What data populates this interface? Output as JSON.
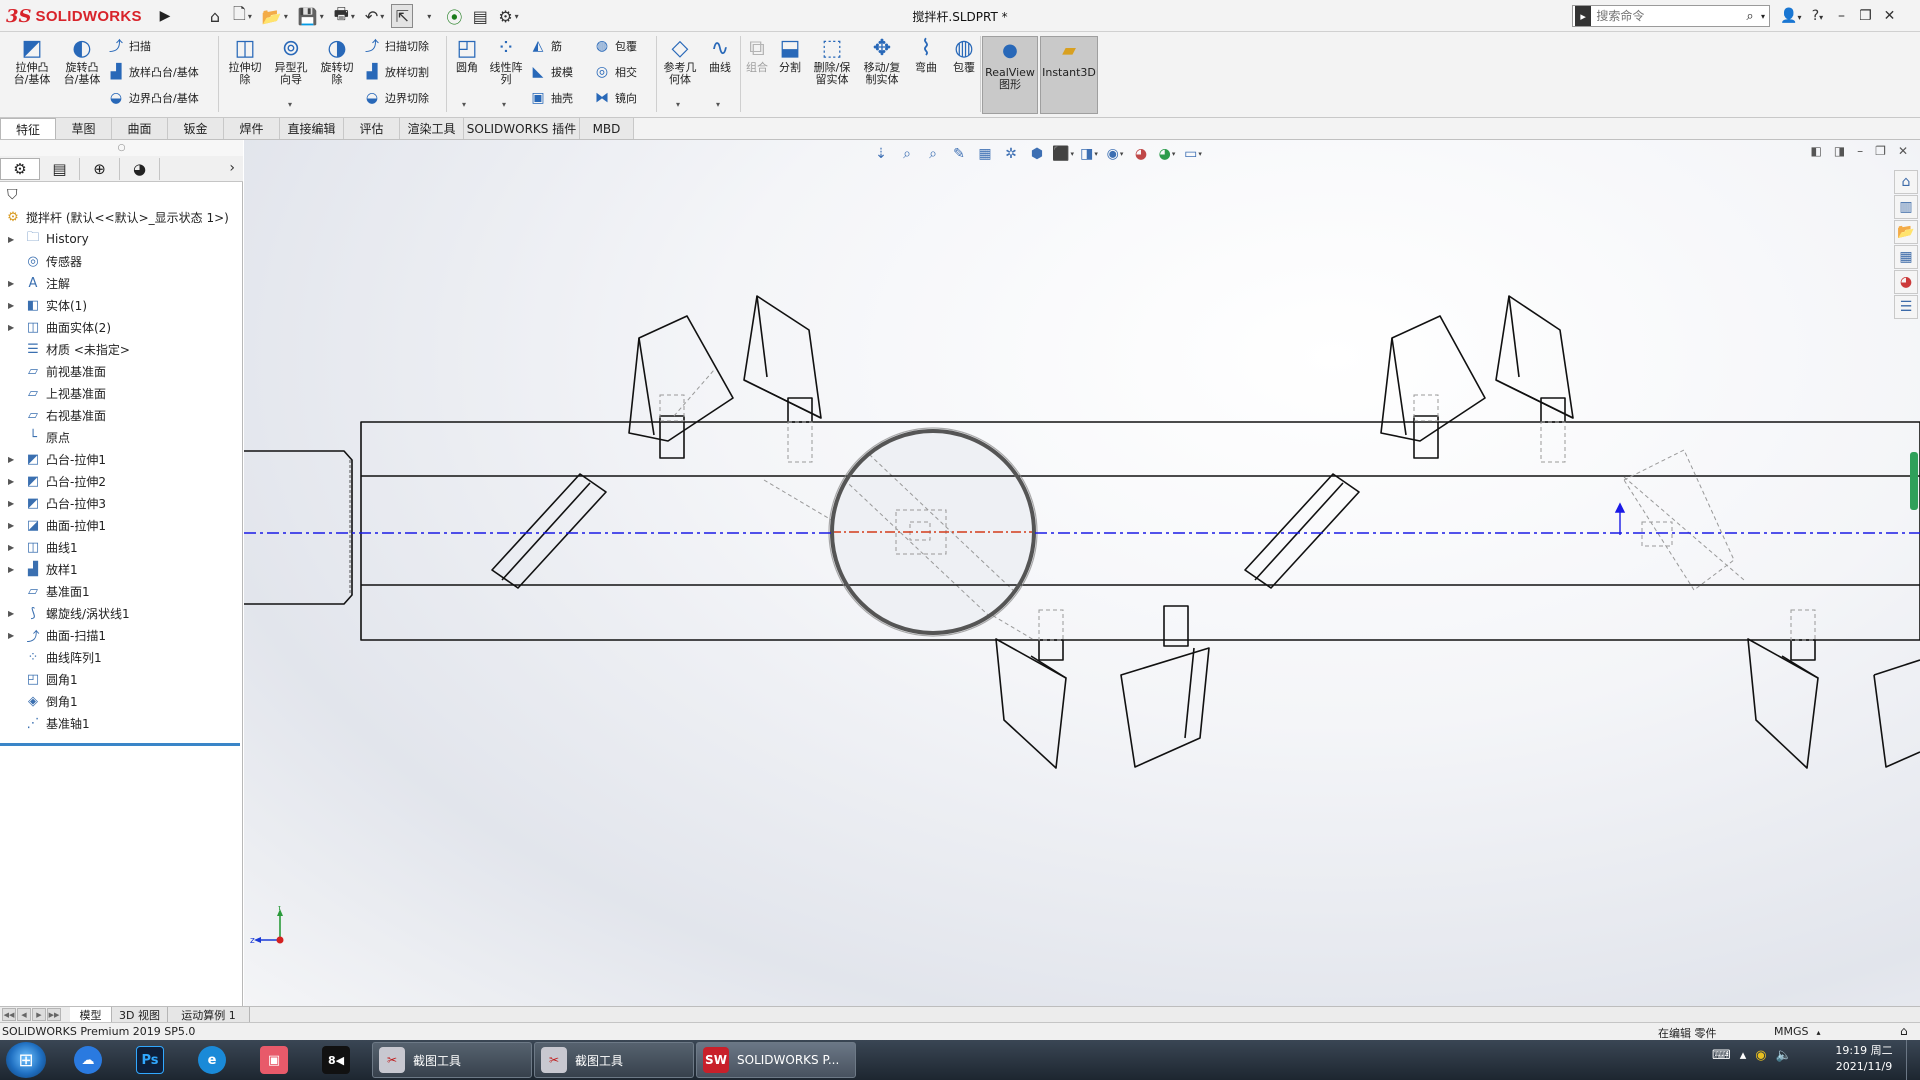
{
  "app": {
    "brand_prefix": "3S",
    "brand": "SOLIDWORKS",
    "document_title": "搅拌杆.SLDPRT *"
  },
  "search": {
    "placeholder": "搜索命令"
  },
  "quick_access": [
    {
      "name": "home-icon",
      "glyph": "⌂"
    },
    {
      "name": "new-document-icon",
      "glyph": "🗋"
    },
    {
      "name": "open-icon",
      "glyph": "📂"
    },
    {
      "name": "save-icon",
      "glyph": "💾"
    },
    {
      "name": "print-icon",
      "glyph": "🖶"
    },
    {
      "name": "undo-icon",
      "glyph": "↶"
    },
    {
      "name": "select-arrow-icon",
      "glyph": "⇱"
    },
    {
      "name": "rebuild-icon",
      "glyph": "⦿"
    },
    {
      "name": "file-properties-icon",
      "glyph": "▤"
    },
    {
      "name": "options-gear-icon",
      "glyph": "⚙"
    }
  ],
  "commands": {
    "extrude_boss": "拉伸凸\n台/基体",
    "revolve_boss": "旋转凸\n台/基体",
    "sweep": "扫描",
    "loft_boss": "放样凸台/基体",
    "boundary_boss": "边界凸台/基体",
    "extrude_cut": "拉伸切\n除",
    "hole_wizard": "异型孔\n向导",
    "revolve_cut": "旋转切\n除",
    "swept_cut": "扫描切除",
    "lofted_cut": "放样切割",
    "boundary_cut": "边界切除",
    "fillet": "圆角",
    "linear_pattern": "线性阵\n列",
    "rib": "筋",
    "draft": "拔模",
    "shell": "抽壳",
    "wrap": "包覆",
    "intersect": "相交",
    "mirror": "镜向",
    "ref_geometry": "参考几\n何体",
    "curves": "曲线",
    "combine": "组合",
    "split": "分割",
    "delete_keep_body": "删除/保\n留实体",
    "move_copy_body": "移动/复\n制实体",
    "flex": "弯曲",
    "wrap2": "包覆",
    "realview": "RealView\n图形",
    "instant3d": "Instant3D"
  },
  "tabs": [
    "特征",
    "草图",
    "曲面",
    "钣金",
    "焊件",
    "直接编辑",
    "评估",
    "渲染工具",
    "SOLIDWORKS 插件",
    "MBD"
  ],
  "active_tab": "特征",
  "tree": {
    "root": "搅拌杆 (默认<<默认>_显示状态 1>)",
    "items": [
      {
        "label": "History",
        "icon": "history-folder-icon",
        "glyph": "🗀",
        "expandable": true
      },
      {
        "label": "传感器",
        "icon": "sensors-icon",
        "glyph": "◎",
        "expandable": false
      },
      {
        "label": "注解",
        "icon": "annotations-icon",
        "glyph": "A",
        "expandable": true
      },
      {
        "label": "实体(1)",
        "icon": "solid-bodies-icon",
        "glyph": "◧",
        "expandable": true
      },
      {
        "label": "曲面实体(2)",
        "icon": "surface-bodies-icon",
        "glyph": "◫",
        "expandable": true
      },
      {
        "label": "材质 <未指定>",
        "icon": "material-icon",
        "glyph": "☰",
        "expandable": false
      },
      {
        "label": "前视基准面",
        "icon": "plane-icon",
        "glyph": "▱",
        "expandable": false
      },
      {
        "label": "上视基准面",
        "icon": "plane-icon",
        "glyph": "▱",
        "expandable": false
      },
      {
        "label": "右视基准面",
        "icon": "plane-icon",
        "glyph": "▱",
        "expandable": false
      },
      {
        "label": "原点",
        "icon": "origin-icon",
        "glyph": "└",
        "expandable": false
      },
      {
        "label": "凸台-拉伸1",
        "icon": "boss-extrude-icon",
        "glyph": "◩",
        "expandable": true
      },
      {
        "label": "凸台-拉伸2",
        "icon": "boss-extrude-icon",
        "glyph": "◩",
        "expandable": true
      },
      {
        "label": "凸台-拉伸3",
        "icon": "boss-extrude-icon",
        "glyph": "◩",
        "expandable": true
      },
      {
        "label": "曲面-拉伸1",
        "icon": "surface-extrude-icon",
        "glyph": "◪",
        "expandable": true
      },
      {
        "label": "曲线1",
        "icon": "curve-icon",
        "glyph": "◫",
        "expandable": true
      },
      {
        "label": "放样1",
        "icon": "loft-icon",
        "glyph": "▟",
        "expandable": true
      },
      {
        "label": "基准面1",
        "icon": "plane-icon",
        "glyph": "▱",
        "expandable": false
      },
      {
        "label": "螺旋线/涡状线1",
        "icon": "helix-icon",
        "glyph": "⟆",
        "expandable": true
      },
      {
        "label": "曲面-扫描1",
        "icon": "surface-sweep-icon",
        "glyph": "⤴",
        "expandable": true
      },
      {
        "label": "曲线阵列1",
        "icon": "curve-pattern-icon",
        "glyph": "⁘",
        "expandable": false
      },
      {
        "label": "圆角1",
        "icon": "fillet-icon",
        "glyph": "◰",
        "expandable": false
      },
      {
        "label": "倒角1",
        "icon": "chamfer-icon",
        "glyph": "◈",
        "expandable": false
      },
      {
        "label": "基准轴1",
        "icon": "axis-icon",
        "glyph": "⋰",
        "expandable": false
      }
    ]
  },
  "bottom_tabs": [
    "模型",
    "3D 视图",
    "运动算例 1"
  ],
  "status": {
    "product": "SOLIDWORKS Premium 2019 SP5.0",
    "edit_state": "在编辑 零件",
    "units": "MMGS"
  },
  "taskbar": {
    "tasks": [
      "截图工具",
      "截图工具",
      "SOLIDWORKS P..."
    ],
    "pinned": [
      "Ps"
    ],
    "time": "19:19 周二",
    "date": "2021/11/9"
  },
  "colors": {
    "brand_red": "#d8232a",
    "axis_blue": "#1a1ae6",
    "accent_blue": "#2868b8"
  }
}
